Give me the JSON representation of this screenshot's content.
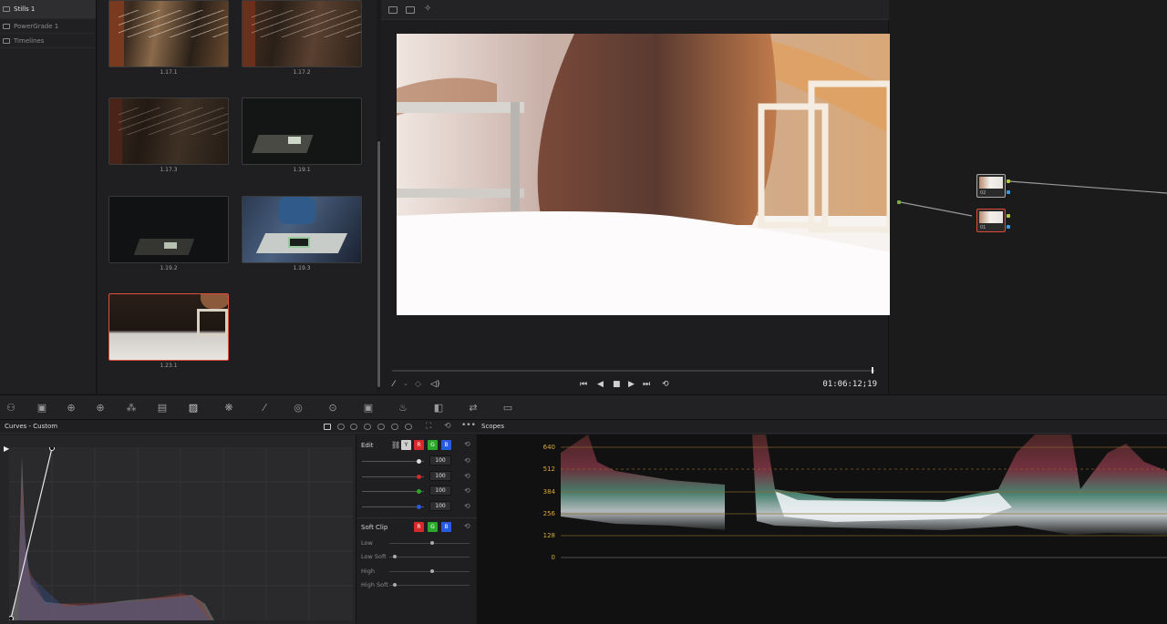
{
  "albums": [
    {
      "label": "Stills 1",
      "selected": true
    },
    {
      "label": "PowerGrade 1",
      "selected": false
    },
    {
      "label": "Timelines",
      "selected": false
    }
  ],
  "stills": [
    {
      "label": "1.17.1"
    },
    {
      "label": "1.17.2"
    },
    {
      "label": "1.17.3"
    },
    {
      "label": "1.19.1"
    },
    {
      "label": "1.19.2"
    },
    {
      "label": "1.19.3"
    },
    {
      "label": "1.23.1",
      "selected": true
    }
  ],
  "viewer": {
    "timecode": "01:06:12;19",
    "playhead_fraction": 0.995
  },
  "nodes": [
    {
      "label": "02",
      "selected": false
    },
    {
      "label": "01",
      "selected": true
    }
  ],
  "palette_icons": [
    "camera-raw-icon",
    "color-match-icon",
    "color-wheels-icon",
    "rgb-mixer-icon",
    "motion-effects-icon",
    "hdr-icon",
    "curves-icon",
    "color-warper-icon",
    "qualifier-icon",
    "window-icon",
    "tracker-icon",
    "magic-mask-icon",
    "blur-icon",
    "key-icon",
    "sizing-icon",
    "3d-icon"
  ],
  "curves": {
    "title": "Curves - Custom",
    "edit_label": "Edit",
    "channels": [
      "Y",
      "R",
      "G",
      "B"
    ],
    "intensity_values": [
      "100",
      "100",
      "100",
      "100"
    ],
    "soft_clip_label": "Soft Clip",
    "soft_clip_rows": [
      "Low",
      "Low Soft",
      "High",
      "High Soft"
    ]
  },
  "scopes": {
    "title": "Scopes",
    "scale": [
      "640",
      "512",
      "384",
      "256",
      "128",
      "0"
    ]
  },
  "colors": {
    "accent_red": "#e04a3a",
    "scale_gold": "#d4a93a",
    "chan_red": "#d62a2a",
    "chan_green": "#2aa82a",
    "chan_blue": "#2a5ae0"
  }
}
